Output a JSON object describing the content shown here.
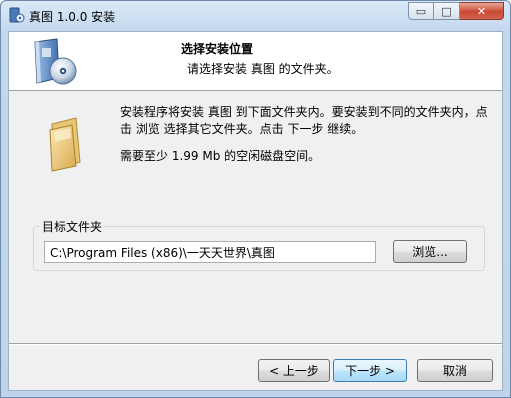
{
  "window": {
    "title": "真图 1.0.0 安装",
    "minimize_glyph": "▭",
    "maximize_glyph": "□",
    "close_glyph": "✕"
  },
  "header": {
    "title": "选择安装位置",
    "subtitle": "请选择安装 真图 的文件夹。"
  },
  "body": {
    "description": "安装程序将安装 真图 到下面文件夹内。要安装到不同的文件夹内，点击 浏览 选择其它文件夹。点击 下一步 继续。",
    "space_required": "需要至少 1.99 Mb 的空闲磁盘空间。"
  },
  "destination": {
    "group_label": "目标文件夹",
    "path": "C:\\Program Files (x86)\\一天天世界\\真图",
    "browse_label": "浏览..."
  },
  "buttons": {
    "back_label": "< 上一步",
    "next_label": "下一步 >",
    "cancel_label": "取消"
  },
  "icons": {
    "app": "installer-app-icon",
    "header": "installer-disc-box-icon",
    "folder": "folder-icon"
  }
}
